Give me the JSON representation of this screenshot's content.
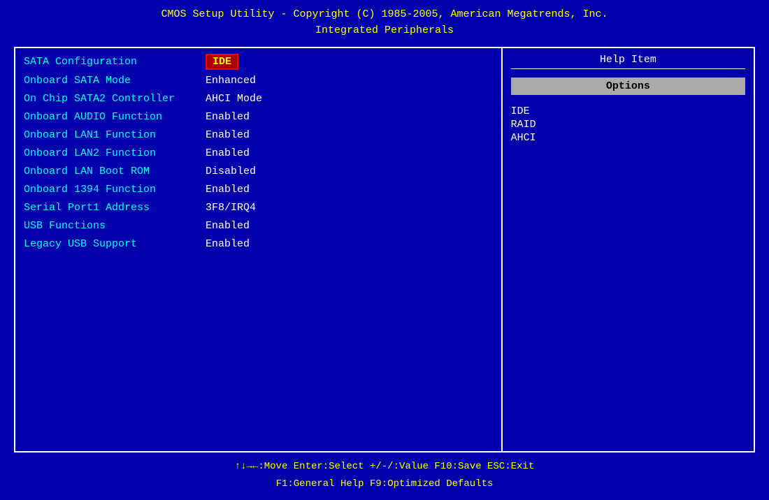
{
  "header": {
    "line1": "CMOS Setup Utility - Copyright (C) 1985-2005, American Megatrends, Inc.",
    "line2": "Integrated Peripherals"
  },
  "rows": [
    {
      "label": "SATA Configuration",
      "value": "IDE",
      "selected": true
    },
    {
      "label": "Onboard SATA Mode",
      "value": "Enhanced",
      "selected": false
    },
    {
      "label": "On Chip SATA2 Controller",
      "value": "AHCI Mode",
      "selected": false
    },
    {
      "label": "Onboard AUDIO Function",
      "value": "Enabled",
      "selected": false
    },
    {
      "label": "Onboard LAN1 Function",
      "value": "Enabled",
      "selected": false
    },
    {
      "label": "Onboard LAN2 Function",
      "value": "Enabled",
      "selected": false
    },
    {
      "label": "Onboard LAN Boot ROM",
      "value": "Disabled",
      "selected": false
    },
    {
      "label": "Onboard 1394 Function",
      "value": "Enabled",
      "selected": false
    },
    {
      "label": "Serial Port1 Address",
      "value": "3F8/IRQ4",
      "selected": false
    },
    {
      "label": "USB Functions",
      "value": "Enabled",
      "selected": false
    },
    {
      "label": "Legacy USB Support",
      "value": "Enabled",
      "selected": false
    }
  ],
  "help": {
    "title": "Help Item",
    "options_label": "Options",
    "options": [
      "IDE",
      "RAID",
      "AHCI"
    ]
  },
  "footer": {
    "line1": "↑↓→←:Move   Enter:Select   +/-/:Value   F10:Save   ESC:Exit",
    "line2": "F1:General Help                    F9:Optimized Defaults"
  }
}
